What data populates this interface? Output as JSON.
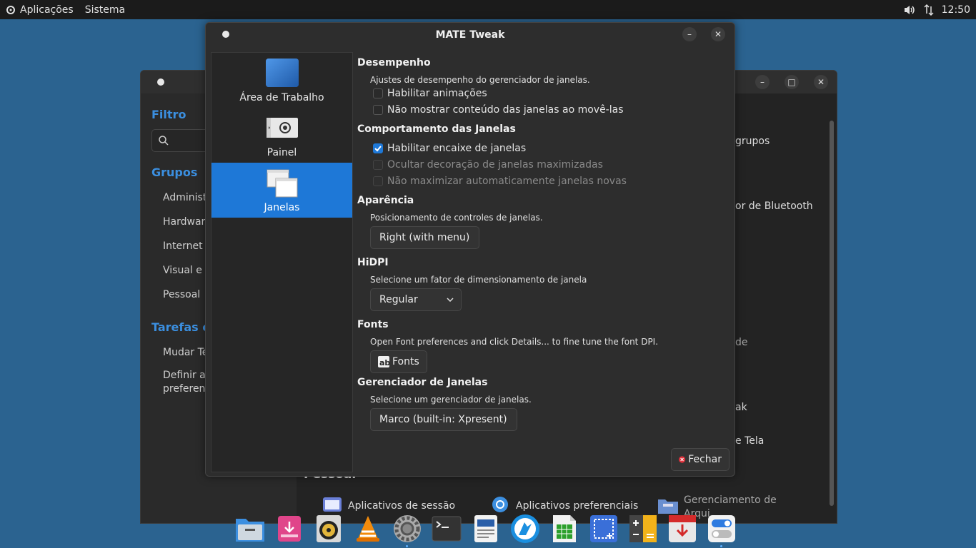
{
  "top_panel": {
    "menu_apps": "Aplicações",
    "menu_system": "Sistema",
    "clock": "12:50"
  },
  "background_window": {
    "sidebar": {
      "filter_title": "Filtro",
      "groups_title": "Grupos",
      "group_items": [
        "Administr",
        "Hardware",
        "Internet e",
        "Visual e C",
        "Pessoal"
      ],
      "tasks_title": "Tarefas co",
      "task_items": [
        "Mudar Te",
        "Definir ap",
        "preferenc"
      ]
    },
    "main_fragments": {
      "frag1": "grupos",
      "frag2": "or de Bluetooth",
      "frag3": "de",
      "frag4": "ak",
      "frag5": "e Tela",
      "section_personal": "Pessoal",
      "app1": "Aplicativos de sessão",
      "app2": "Aplicativos preferenciais",
      "app3": "Gerenciamento de",
      "app3_cont": "Arqui"
    }
  },
  "tweak": {
    "title": "MATE Tweak",
    "sidebar": [
      {
        "label": "Área de Trabalho"
      },
      {
        "label": "Painel"
      },
      {
        "label": "Janelas"
      }
    ],
    "performance": {
      "title": "Desempenho",
      "desc": "Ajustes de desempenho do gerenciador de janelas.",
      "opt1": "Habilitar animações",
      "opt2": "Não mostrar conteúdo das janelas ao movê-las"
    },
    "behavior": {
      "title": "Comportamento das Janelas",
      "opt1": "Habilitar encaixe de janelas",
      "opt2": "Ocultar decoração de janelas maximizadas",
      "opt3": "Não maximizar automaticamente janelas novas"
    },
    "appearance": {
      "title": "Aparência",
      "desc": "Posicionamento de controles de janelas.",
      "value": "Right (with menu)"
    },
    "hidpi": {
      "title": "HiDPI",
      "desc": "Selecione um fator de dimensionamento de janela",
      "value": "Regular"
    },
    "fonts": {
      "title": "Fonts",
      "desc": "Open Font preferences and click Details... to fine tune the font DPI.",
      "button": "Fonts"
    },
    "wm": {
      "title": "Gerenciador de Janelas",
      "desc": "Selecione um gerenciador de janelas.",
      "value": "Marco (built-in: Xpresent)"
    },
    "close_button": "Fechar"
  },
  "dock_icons": [
    "file-manager-icon",
    "software-installer-icon",
    "music-player-icon",
    "vlc-icon",
    "settings-icon",
    "terminal-icon",
    "document-viewer-icon",
    "web-browser-icon",
    "spreadsheet-icon",
    "screenshot-icon",
    "calculator-icon",
    "update-manager-icon",
    "control-toggle-icon"
  ]
}
